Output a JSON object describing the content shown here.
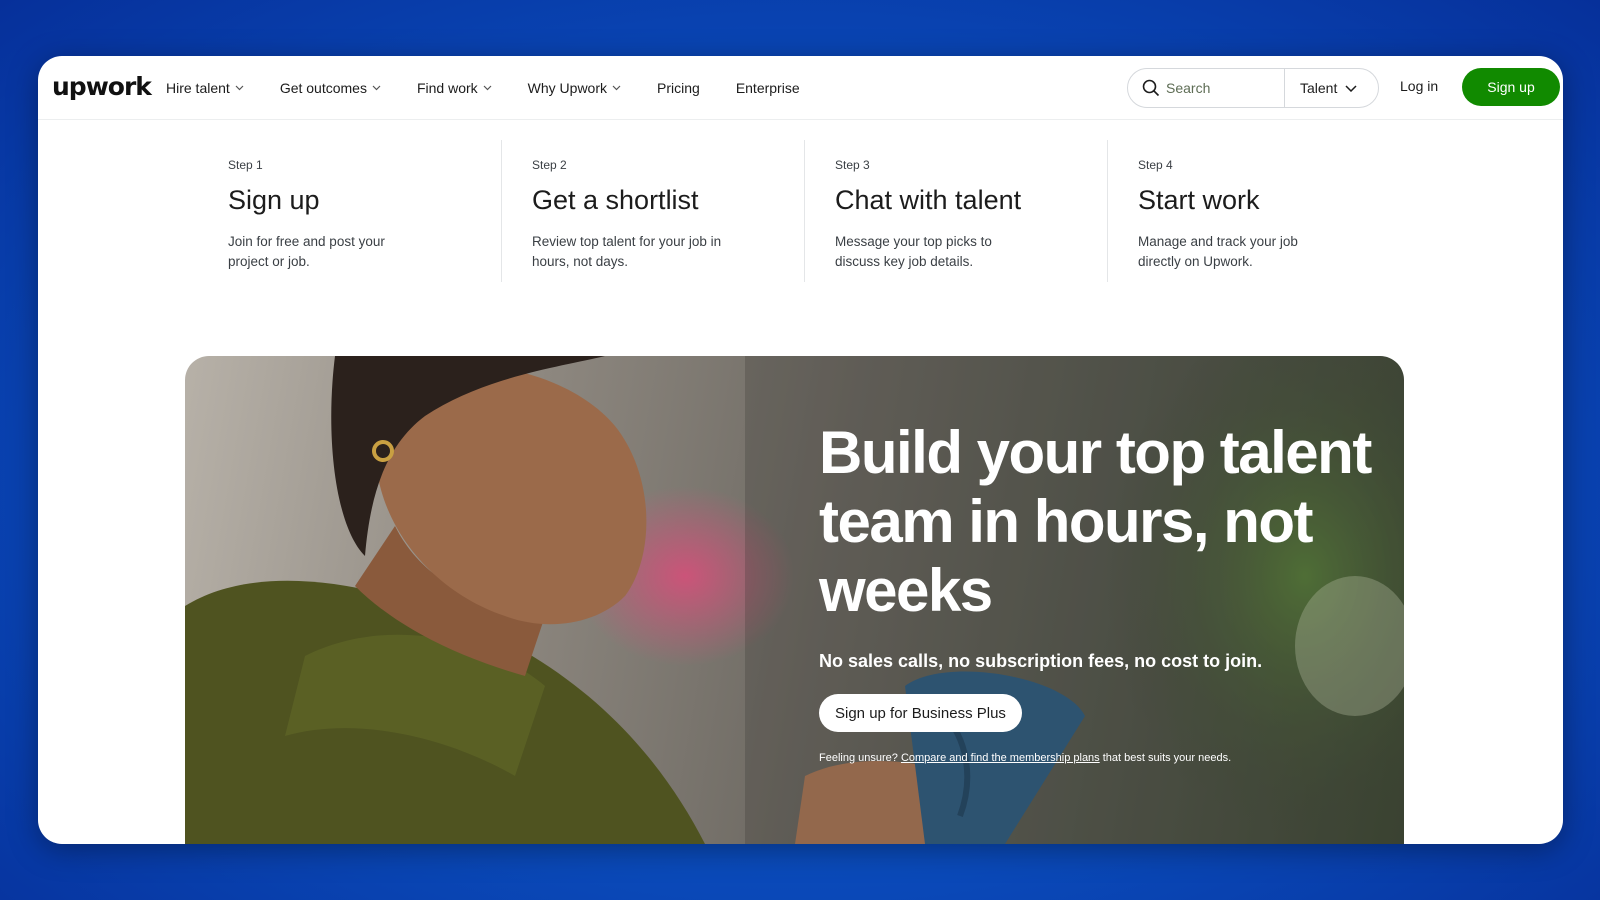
{
  "nav": {
    "logo": "upwork",
    "links": [
      {
        "label": "Hire talent",
        "dropdown": true
      },
      {
        "label": "Get outcomes",
        "dropdown": true
      },
      {
        "label": "Find work",
        "dropdown": true
      },
      {
        "label": "Why Upwork",
        "dropdown": true
      },
      {
        "label": "Pricing",
        "dropdown": false
      },
      {
        "label": "Enterprise",
        "dropdown": false
      }
    ],
    "search_placeholder": "Search",
    "search_scope": "Talent",
    "login": "Log in",
    "signup": "Sign up"
  },
  "steps": [
    {
      "num": "Step 1",
      "title": "Sign up",
      "desc": "Join for free and post your project or job."
    },
    {
      "num": "Step 2",
      "title": "Get a shortlist",
      "desc": "Review top talent for your job in hours, not days."
    },
    {
      "num": "Step 3",
      "title": "Chat with talent",
      "desc": "Message your top picks to discuss key job details."
    },
    {
      "num": "Step 4",
      "title": "Start work",
      "desc": "Manage and track your job directly on Upwork."
    }
  ],
  "hero": {
    "title": "Build your top talent team in hours, not weeks",
    "subtitle": "No sales calls, no subscription fees, no cost to join.",
    "cta": "Sign up for Business Plus",
    "note_prefix": "Feeling unsure?",
    "note_link": "Compare and find the membership plans",
    "note_suffix": "that best suits your needs."
  },
  "colors": {
    "brand_green": "#118a00",
    "background_blue": "#0b4fc0"
  },
  "icons": [
    "search-icon",
    "chevron-down-icon"
  ]
}
